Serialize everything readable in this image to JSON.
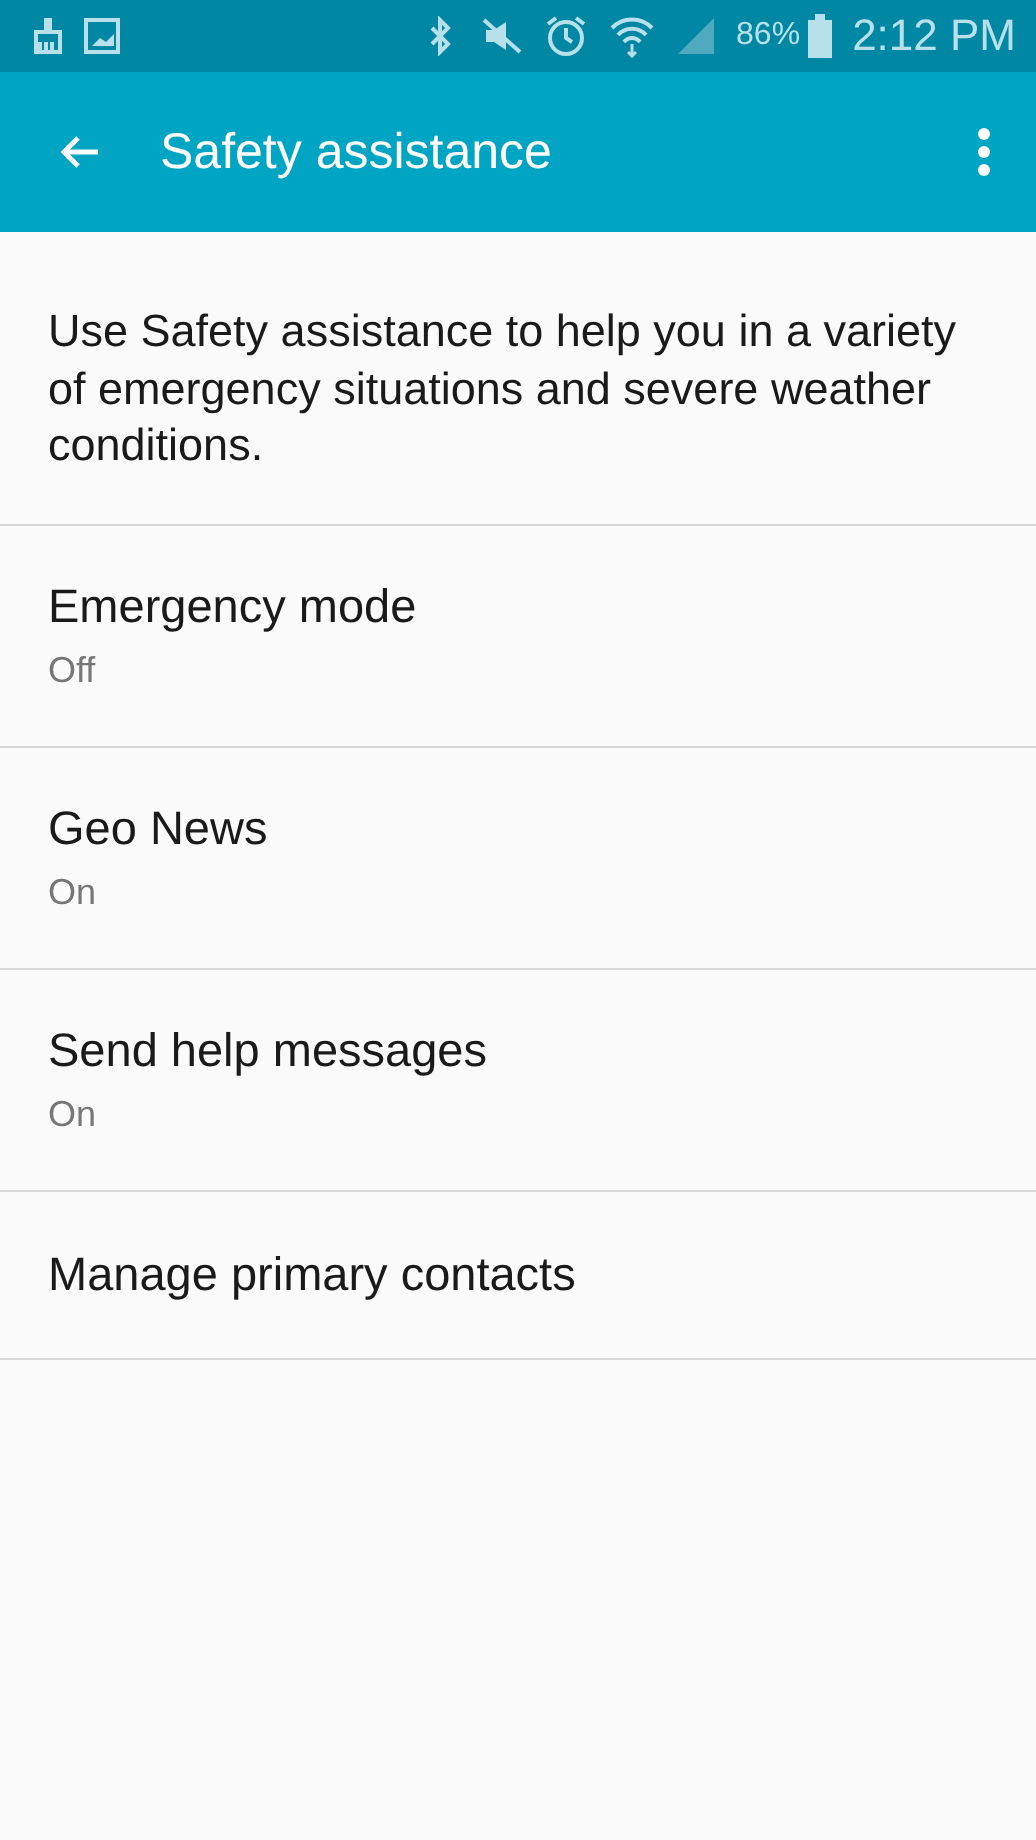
{
  "status_bar": {
    "battery": "86%",
    "time": "2:12 PM"
  },
  "toolbar": {
    "title": "Safety assistance"
  },
  "description": "Use Safety assistance to help you in a variety of emergency situations and severe weather conditions.",
  "items": [
    {
      "title": "Emergency mode",
      "summary": "Off"
    },
    {
      "title": "Geo News",
      "summary": "On"
    },
    {
      "title": "Send help messages",
      "summary": "On"
    },
    {
      "title": "Manage primary contacts"
    }
  ]
}
